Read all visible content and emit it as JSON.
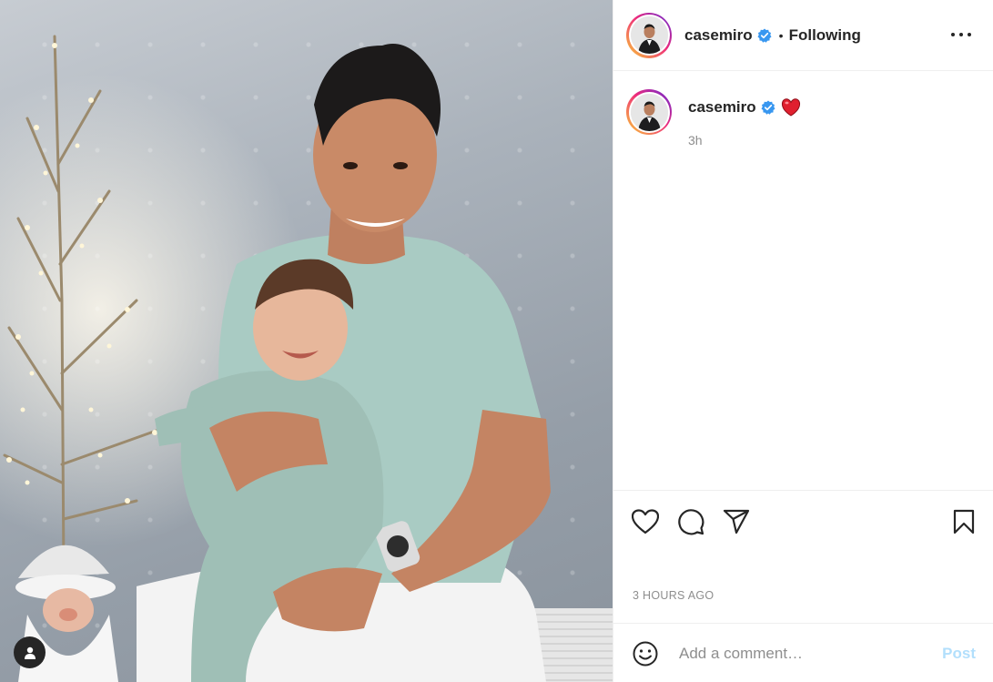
{
  "post": {
    "author": {
      "username": "casemiro",
      "verified": true,
      "avatar_icon": "profile-photo-man-in-suit"
    },
    "follow_state": "Following",
    "separator": "•",
    "caption": {
      "emoji": "red-heart",
      "relative_time": "3h"
    },
    "timestamp": "3 HOURS AGO",
    "actions": {
      "like_icon": "heart-outline-icon",
      "comment_icon": "speech-bubble-icon",
      "share_icon": "paper-plane-icon",
      "save_icon": "bookmark-icon"
    },
    "comment_box": {
      "placeholder": "Add a comment…",
      "post_label": "Post"
    }
  },
  "colors": {
    "text": "#262626",
    "muted": "#8e8e8e",
    "verified": "#3897f0",
    "post_disabled": "#b2dffc",
    "heart": "#ed4956",
    "divider": "#efefef"
  }
}
